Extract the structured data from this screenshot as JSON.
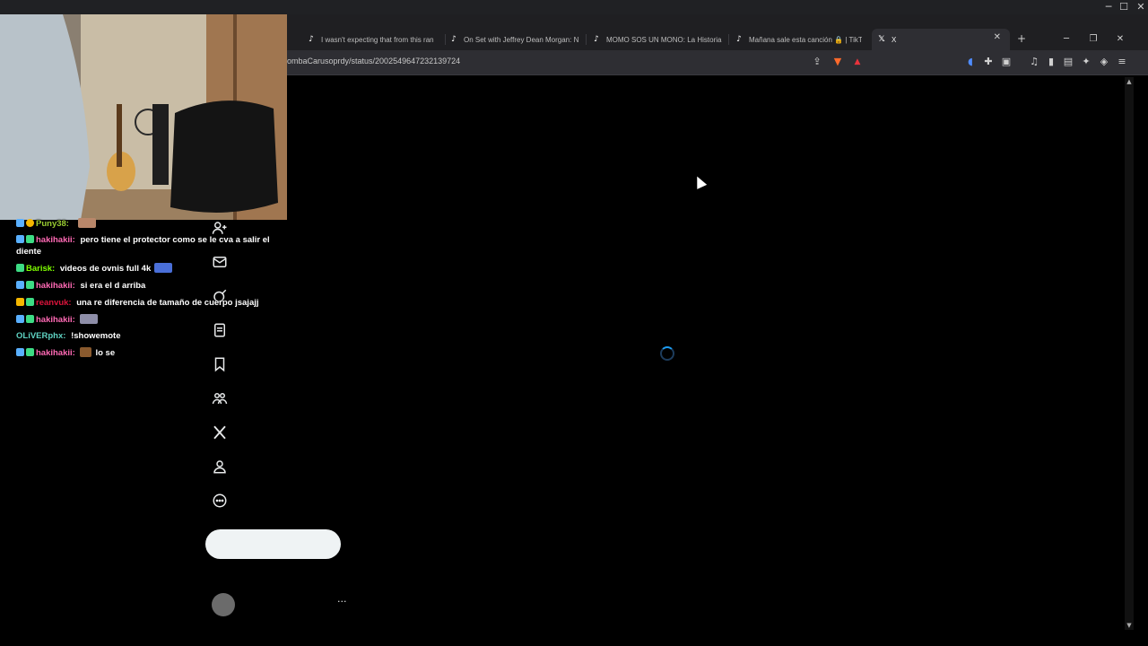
{
  "outer_window": {
    "controls": [
      "─",
      "☐",
      "✕"
    ]
  },
  "browser": {
    "tabs": [
      {
        "favicon": "tiktok-icon",
        "title": "I wasn't expecting that from this ran"
      },
      {
        "favicon": "tiktok-icon",
        "title": "On Set with Jeffrey Dean Morgan: N"
      },
      {
        "favicon": "tiktok-icon",
        "title": "MOMO SOS UN MONO: La Historia"
      },
      {
        "favicon": "tiktok-icon",
        "title": "Mañana sale esta canción 🔒 | TikTo"
      },
      {
        "favicon": "x-icon",
        "title": "X",
        "active": true
      }
    ],
    "tab_close": "✕",
    "new_tab": "+",
    "window_controls": [
      "─",
      "❐",
      "✕"
    ],
    "url": "ombaCarusoprdy/status/2002549647232139724",
    "toolbar_icons": [
      "share-icon",
      "brave-shield-icon",
      "brave-rewards-icon",
      "audio-icon",
      "extensions-icon",
      "screenshot-icon",
      "media-icon",
      "sidebar-icon",
      "wallet-icon",
      "leo-icon",
      "vpn-icon",
      "menu-icon"
    ]
  },
  "x_nav": {
    "icons": [
      "follow-icon",
      "messages-icon",
      "grok-icon",
      "lists-icon",
      "bookmarks-icon",
      "communities-icon",
      "premium-x-icon",
      "profile-icon",
      "more-icon"
    ],
    "more_dots": "···"
  },
  "chat": {
    "messages": [
      {
        "user": "Puny38:",
        "user_color": "#9acd32",
        "text": "",
        "emote": true
      },
      {
        "user": "hakihakii:",
        "user_color": "#ff69b4",
        "text": "pero tiene el protector como se le cva a salir el",
        "continuation": "diente"
      },
      {
        "user": "Barisk:",
        "user_color": "#7fff00",
        "text": "videos de ovnis full 4k",
        "emote": true
      },
      {
        "user": "hakihakii:",
        "user_color": "#ff69b4",
        "text": "si era el d arriba"
      },
      {
        "user": "reanvuk:",
        "user_color": "#dc143c",
        "text": "una re diferencia de tamaño de cuerpo jsajajj"
      },
      {
        "user": "hakihakii:",
        "user_color": "#ff69b4",
        "text": "",
        "emote": true
      },
      {
        "user": "OLiVERphx:",
        "user_color": "#5fd3c3",
        "text": "!showemote"
      },
      {
        "user": "hakihakii:",
        "user_color": "#ff69b4",
        "text": "lo se",
        "emote": true
      }
    ]
  }
}
